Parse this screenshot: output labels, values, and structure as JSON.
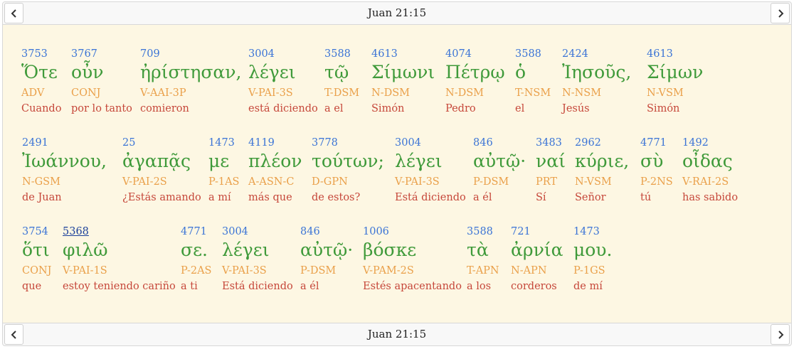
{
  "nav": {
    "reference": "Juan 21:15"
  },
  "rows": [
    [
      {
        "strong": "3753",
        "greek": "Ὅτε",
        "morph": "ADV",
        "trans": "Cuando"
      },
      {
        "strong": "3767",
        "greek": "οὖν",
        "morph": "CONJ",
        "trans": "por lo tanto"
      },
      {
        "strong": "709",
        "greek": "ἠρίστησαν,",
        "morph": "V-AAI-3P",
        "trans": "comieron"
      },
      {
        "strong": "3004",
        "greek": "λέγει",
        "morph": "V-PAI-3S",
        "trans": "está diciendo"
      },
      {
        "strong": "3588",
        "greek": "τῷ",
        "morph": "T-DSM",
        "trans": "a el"
      },
      {
        "strong": "4613",
        "greek": "Σίμωνι",
        "morph": "N-DSM",
        "trans": "Simón"
      },
      {
        "strong": "4074",
        "greek": "Πέτρῳ",
        "morph": "N-DSM",
        "trans": "Pedro"
      },
      {
        "strong": "3588",
        "greek": "ὁ",
        "morph": "T-NSM",
        "trans": "el"
      },
      {
        "strong": "2424",
        "greek": "Ἰησοῦς,",
        "morph": "N-NSM",
        "trans": "Jesús"
      },
      {
        "strong": "4613",
        "greek": "Σίμων",
        "morph": "N-VSM",
        "trans": "Simón"
      }
    ],
    [
      {
        "strong": "2491",
        "greek": "Ἰωάννου,",
        "morph": "N-GSM",
        "trans": "de Juan"
      },
      {
        "strong": "25",
        "greek": "ἀγαπᾷς",
        "morph": "V-PAI-2S",
        "trans": "¿Estás amando"
      },
      {
        "strong": "1473",
        "greek": "με",
        "morph": "P-1AS",
        "trans": "a mí"
      },
      {
        "strong": "4119",
        "greek": "πλέον",
        "morph": "A-ASN-C",
        "trans": "más que"
      },
      {
        "strong": "3778",
        "greek": "τούτων;",
        "morph": "D-GPN",
        "trans": "de estos?"
      },
      {
        "strong": "3004",
        "greek": "λέγει",
        "morph": "V-PAI-3S",
        "trans": "Está diciendo"
      },
      {
        "strong": "846",
        "greek": "αὐτῷ·",
        "morph": "P-DSM",
        "trans": "a él"
      },
      {
        "strong": "3483",
        "greek": "ναί",
        "morph": "PRT",
        "trans": "Sí"
      },
      {
        "strong": "2962",
        "greek": "κύριε,",
        "morph": "N-VSM",
        "trans": "Señor"
      },
      {
        "strong": "4771",
        "greek": "σὺ",
        "morph": "P-2NS",
        "trans": "tú"
      },
      {
        "strong": "1492",
        "greek": "οἶδας",
        "morph": "V-RAI-2S",
        "trans": "has sabido"
      }
    ],
    [
      {
        "strong": "3754",
        "greek": "ὅτι",
        "morph": "CONJ",
        "trans": "que"
      },
      {
        "strong": "5368",
        "greek": "φιλῶ",
        "morph": "V-PAI-1S",
        "trans": "estoy teniendo cariño"
      },
      {
        "strong": "4771",
        "greek": "σε.",
        "morph": "P-2AS",
        "trans": "a ti"
      },
      {
        "strong": "3004",
        "greek": "λέγει",
        "morph": "V-PAI-3S",
        "trans": "Está diciendo"
      },
      {
        "strong": "846",
        "greek": "αὐτῷ·",
        "morph": "P-DSM",
        "trans": "a él"
      },
      {
        "strong": "1006",
        "greek": "βόσκε",
        "morph": "V-PAM-2S",
        "trans": "Estés apacentando"
      },
      {
        "strong": "3588",
        "greek": "τὰ",
        "morph": "T-APN",
        "trans": "a los"
      },
      {
        "strong": "721",
        "greek": "ἀρνία",
        "morph": "N-APN",
        "trans": "corderos"
      },
      {
        "strong": "1473",
        "greek": "μου.",
        "morph": "P-1GS",
        "trans": "de mí"
      }
    ]
  ]
}
